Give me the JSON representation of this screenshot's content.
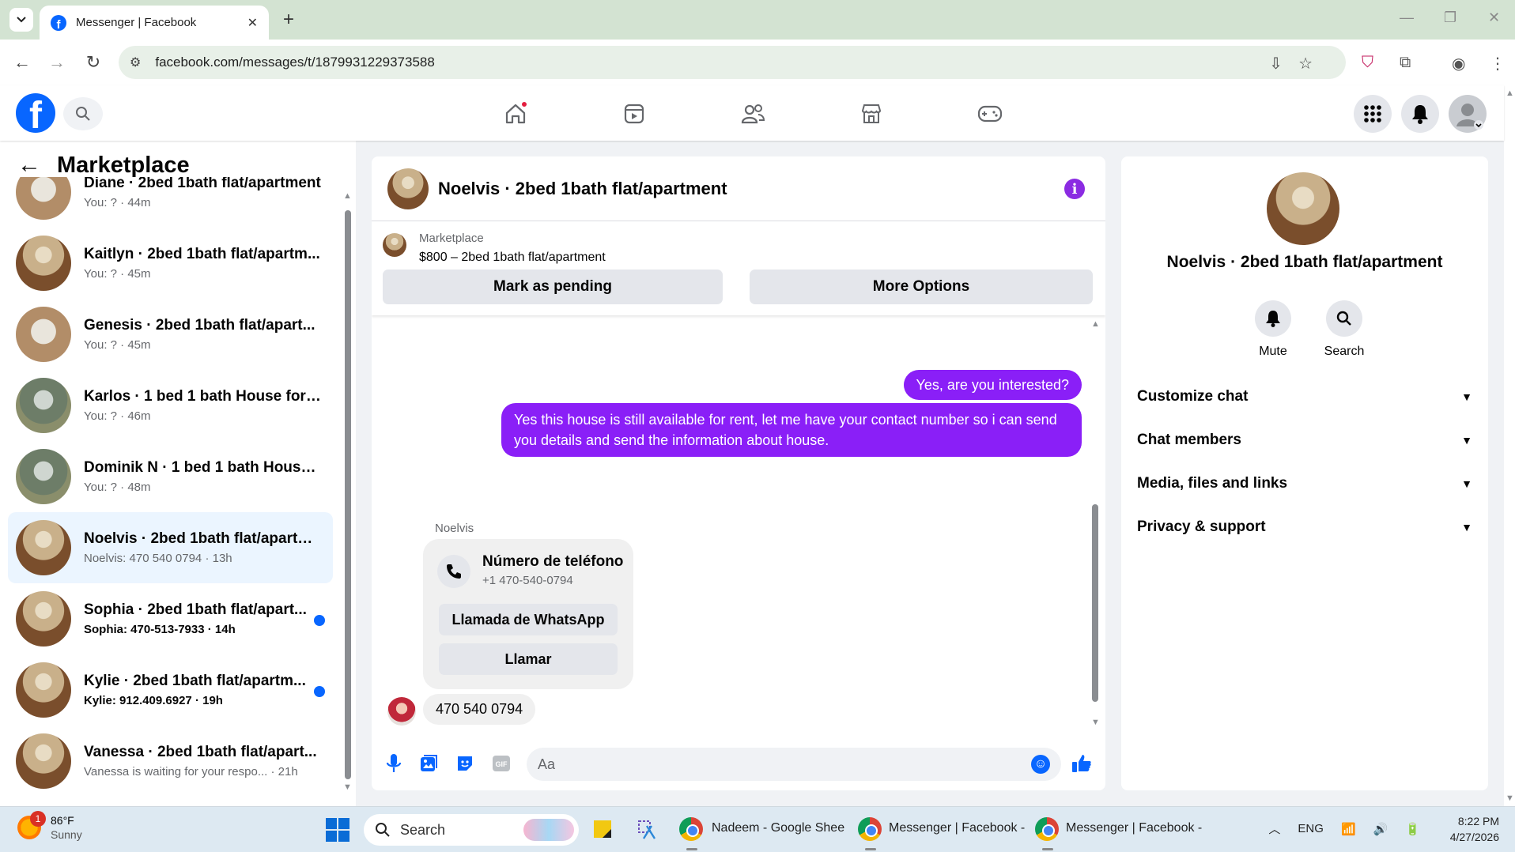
{
  "browser": {
    "tab_title": "Messenger | Facebook",
    "url": "facebook.com/messages/t/1879931229373588"
  },
  "left_panel": {
    "title": "Marketplace",
    "conversations": [
      {
        "name": "Diane · 2bed 1bath flat/apartment",
        "preview": "You: ? · 44m",
        "unread": false
      },
      {
        "name": "Kaitlyn · 2bed 1bath flat/apartm...",
        "preview": "You: ? · 45m",
        "unread": false
      },
      {
        "name": "Genesis · 2bed 1bath flat/apart...",
        "preview": "You: ? · 45m",
        "unread": false
      },
      {
        "name": "Karlos · 1 bed 1 bath House for r...",
        "preview": "You: ? · 46m",
        "unread": false
      },
      {
        "name": "Dominik N · 1 bed 1 bath House ...",
        "preview": "You: ? · 48m",
        "unread": false
      },
      {
        "name": "Noelvis · 2bed 1bath flat/apartm...",
        "preview": "Noelvis: 470 540 0794 · 13h",
        "unread": false,
        "active": true
      },
      {
        "name": "Sophia · 2bed 1bath flat/apart...",
        "preview": "Sophia: 470-513-7933 · 14h",
        "unread": true
      },
      {
        "name": "Kylie · 2bed 1bath flat/apartm...",
        "preview": "Kylie: 912.409.6927 · 19h",
        "unread": true
      },
      {
        "name": "Vanessa · 2bed 1bath flat/apart...",
        "preview": "Vanessa is waiting for your respo...  · 21h",
        "unread": false
      }
    ]
  },
  "chat": {
    "title": "Noelvis · 2bed 1bath flat/apartment",
    "marketplace_label": "Marketplace",
    "listing": "$800 – 2bed 1bath flat/apartment",
    "mark_pending": "Mark as pending",
    "more_options": "More Options",
    "msg_out_1": "Yes, are you interested?",
    "msg_out_2": "Yes this house is still available for rent, let me have your contact number so i can send you details and send the information about house.",
    "sender": "Noelvis",
    "contact_title": "Número de teléfono",
    "contact_number": "+1 470-540-0794",
    "whatsapp_btn": "Llamada de WhatsApp",
    "call_btn": "Llamar",
    "msg_in": "470 540 0794",
    "composer_placeholder": "Aa",
    "gif_label": "GIF"
  },
  "right_panel": {
    "name": "Noelvis · 2bed 1bath flat/apartment",
    "mute": "Mute",
    "search": "Search",
    "sections": [
      "Customize chat",
      "Chat members",
      "Media, files and links",
      "Privacy & support"
    ]
  },
  "taskbar": {
    "temp": "86°F",
    "condition": "Sunny",
    "weather_badge": "1",
    "search": "Search",
    "app1": "Nadeem - Google Shee",
    "app2": "Messenger | Facebook -",
    "app3": "Messenger | Facebook -",
    "lang": "ENG",
    "time": "8:22 PM",
    "date": "4/27/2026"
  },
  "colors": {
    "brand": "#0866ff",
    "outgoing_bubble": "#8a1ff7",
    "unread_dot": "#0866ff",
    "notification_dot": "#e41e3f"
  }
}
